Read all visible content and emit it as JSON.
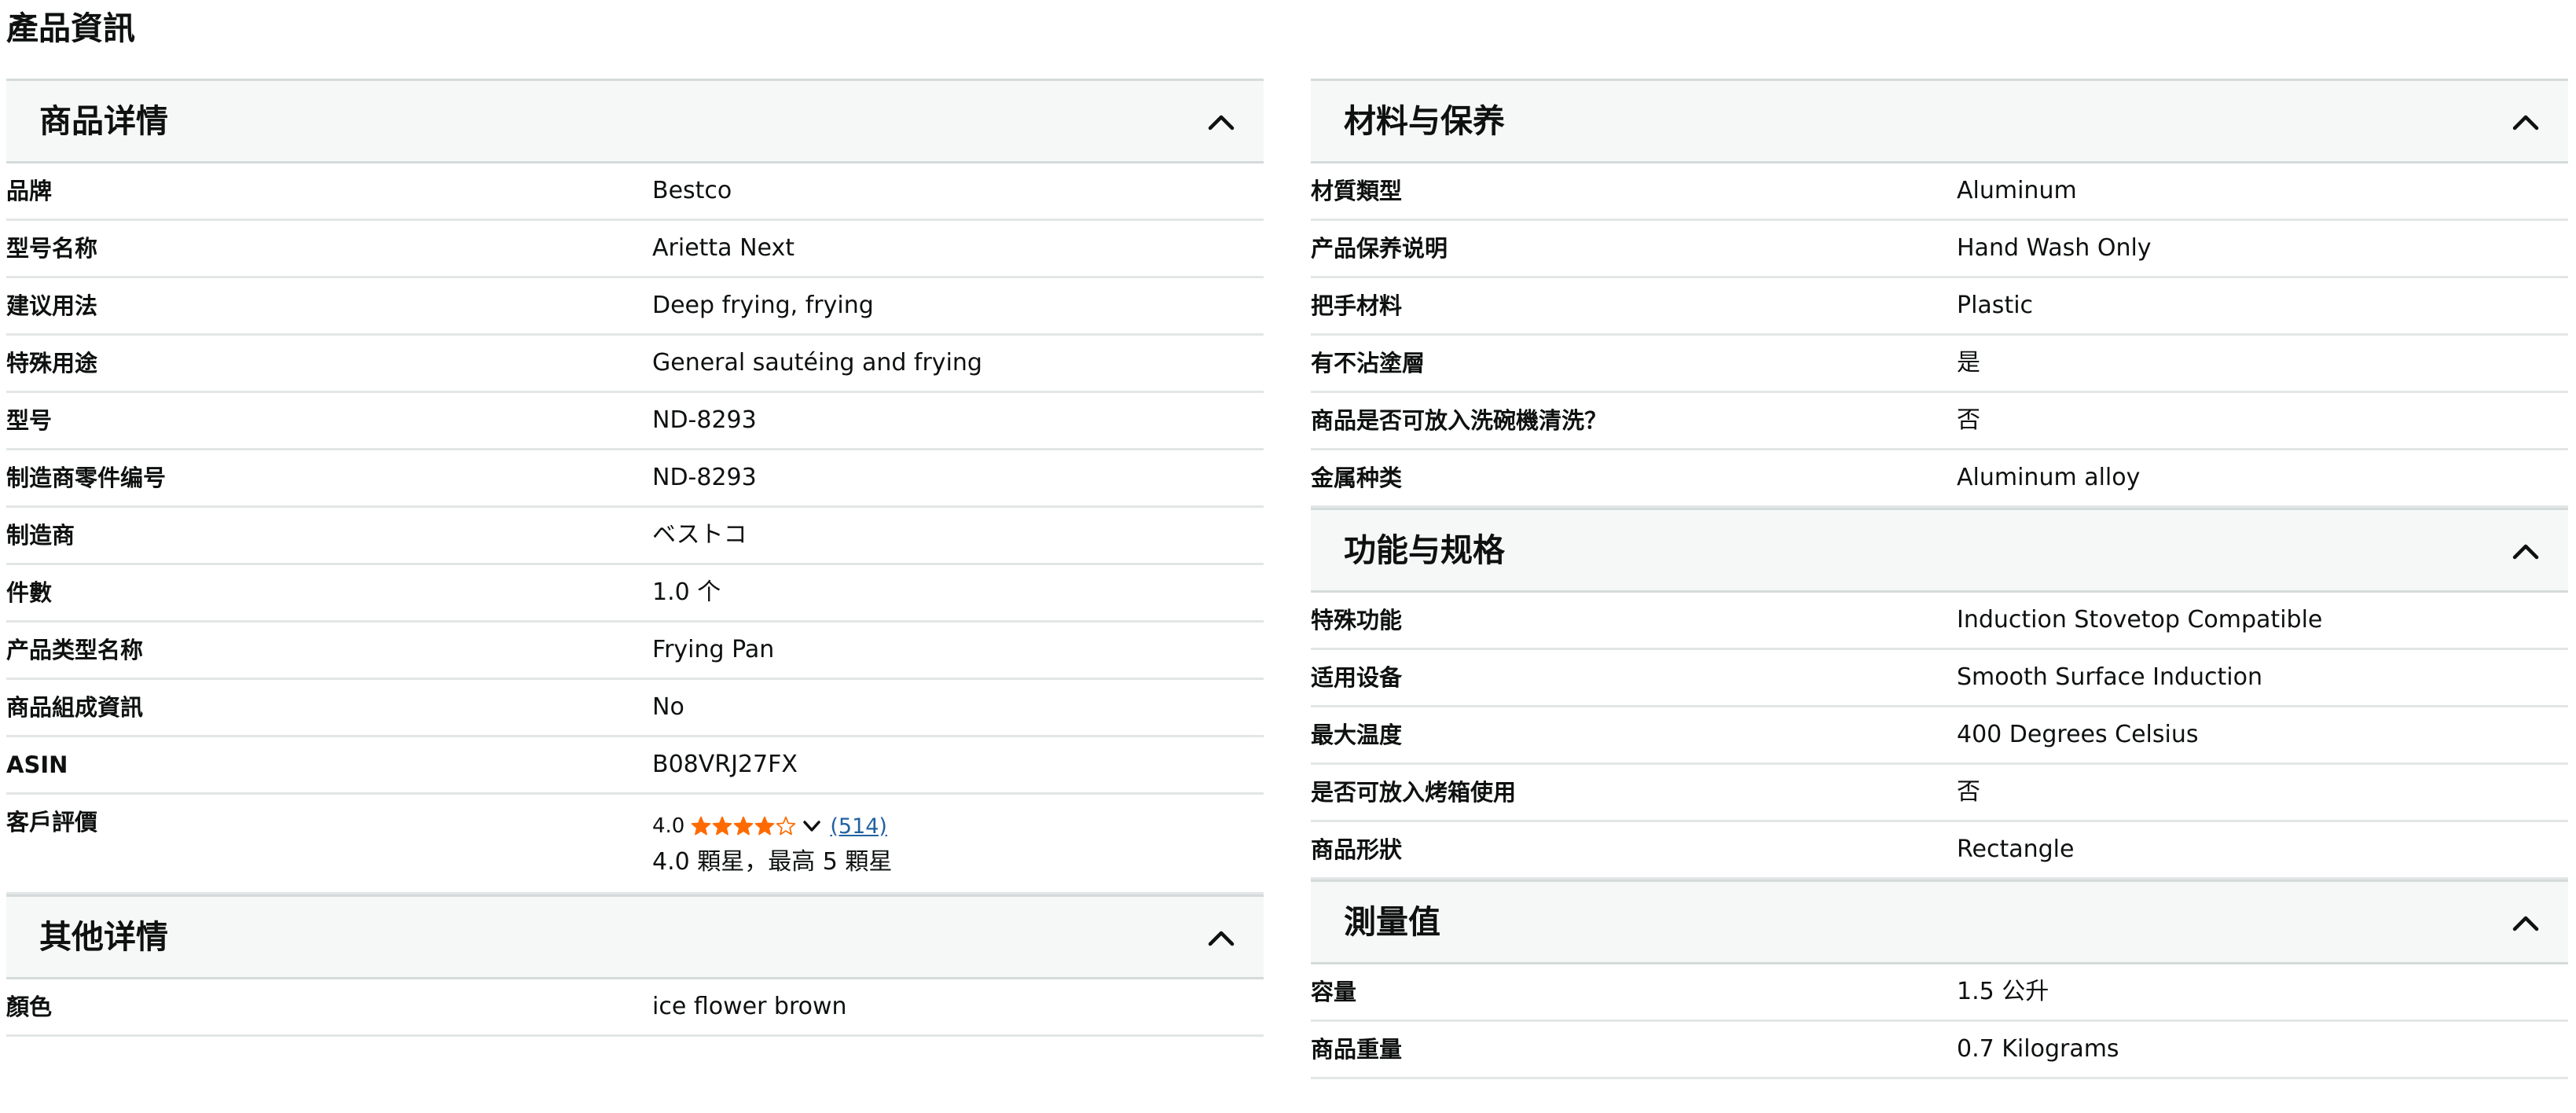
{
  "page_title": "產品資訊",
  "left": {
    "details": {
      "title": "商品详情",
      "rows": [
        {
          "label": "品牌",
          "value": "Bestco"
        },
        {
          "label": "型号名称",
          "value": "Arietta Next"
        },
        {
          "label": "建议用法",
          "value": "Deep frying, frying"
        },
        {
          "label": "特殊用途",
          "value": "General sautéing and frying"
        },
        {
          "label": "型号",
          "value": "ND-8293"
        },
        {
          "label": "制造商零件编号",
          "value": "ND-8293"
        },
        {
          "label": "制造商",
          "value": "ベストコ"
        },
        {
          "label": "件數",
          "value": "1.0 个"
        },
        {
          "label": "产品类型名称",
          "value": "Frying Pan"
        },
        {
          "label": "商品組成資訊",
          "value": "No"
        },
        {
          "label": "ASIN",
          "value": "B08VRJ27FX"
        }
      ],
      "rating": {
        "label": "客戶評價",
        "score": "4.0",
        "stars_value": 4.0,
        "stars_max": 5,
        "reviews": "(514)",
        "desc": "4.0 顆星，最高 5 顆星",
        "star_color": "#ff6a00"
      }
    },
    "other": {
      "title": "其他详情",
      "rows": [
        {
          "label": "顏色",
          "value": "ice flower brown"
        }
      ]
    }
  },
  "right": {
    "materials": {
      "title": "材料与保养",
      "rows": [
        {
          "label": "材質類型",
          "value": "Aluminum"
        },
        {
          "label": "产品保养说明",
          "value": "Hand Wash Only"
        },
        {
          "label": "把手材料",
          "value": "Plastic"
        },
        {
          "label": "有不沾塗層",
          "value": "是"
        },
        {
          "label": "商品是否可放入洗碗機清洗？",
          "value": "否"
        },
        {
          "label": "金属种类",
          "value": "Aluminum alloy"
        }
      ]
    },
    "features": {
      "title": "功能与规格",
      "rows": [
        {
          "label": "特殊功能",
          "value": "Induction Stovetop Compatible"
        },
        {
          "label": "适用设备",
          "value": "Smooth Surface Induction"
        },
        {
          "label": "最大温度",
          "value": "400 Degrees Celsius"
        },
        {
          "label": "是否可放入烤箱使用",
          "value": "否"
        },
        {
          "label": "商品形狀",
          "value": "Rectangle"
        }
      ]
    },
    "measurements": {
      "title": "測量值",
      "rows": [
        {
          "label": "容量",
          "value": "1.5 公升"
        },
        {
          "label": "商品重量",
          "value": "0.7 Kilograms"
        }
      ]
    }
  },
  "icons": {
    "section_toggle": "chevron-up-icon",
    "rating_dropdown": "chevron-down-icon",
    "star": "star-icon"
  }
}
